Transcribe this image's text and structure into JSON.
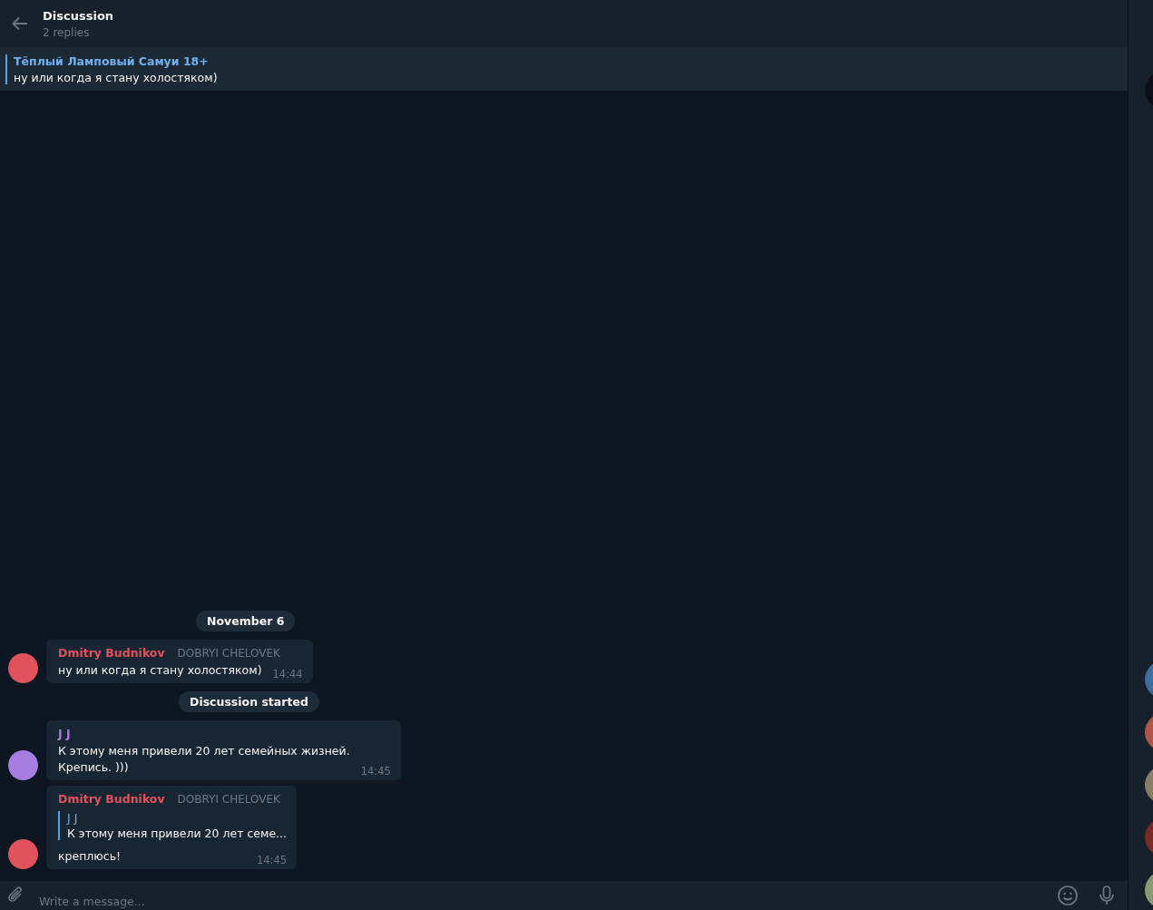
{
  "header": {
    "title": "Discussion",
    "subtitle": "2 replies"
  },
  "pinned": {
    "author": "Тёплый Ламповый Самуи 18+",
    "text": "ну или когда я стану холостяком)"
  },
  "items": [
    {
      "kind": "service",
      "text": "November 6"
    },
    {
      "kind": "message",
      "author": "Dmitry Budnikov",
      "color": "#e0525c",
      "badge": "DOBRYI CHELOVEK",
      "text": "ну или когда я стану холостяком)",
      "time": "14:44"
    },
    {
      "kind": "service",
      "text": "Discussion started"
    },
    {
      "kind": "message",
      "author": "J J",
      "color": "#a67de0",
      "text": "К этому меня привели 20 лет семейных жизней.\nКрепись. )))",
      "time": "14:45"
    },
    {
      "kind": "message",
      "author": "Dmitry Budnikov",
      "color": "#e0525c",
      "badge": "DOBRYI CHELOVEK",
      "reply": {
        "author": "J J",
        "text": "К этому меня привели 20 лет семе..."
      },
      "text": "креплюсь!",
      "time": "14:45"
    }
  ],
  "composer": {
    "placeholder": "Write a message..."
  }
}
